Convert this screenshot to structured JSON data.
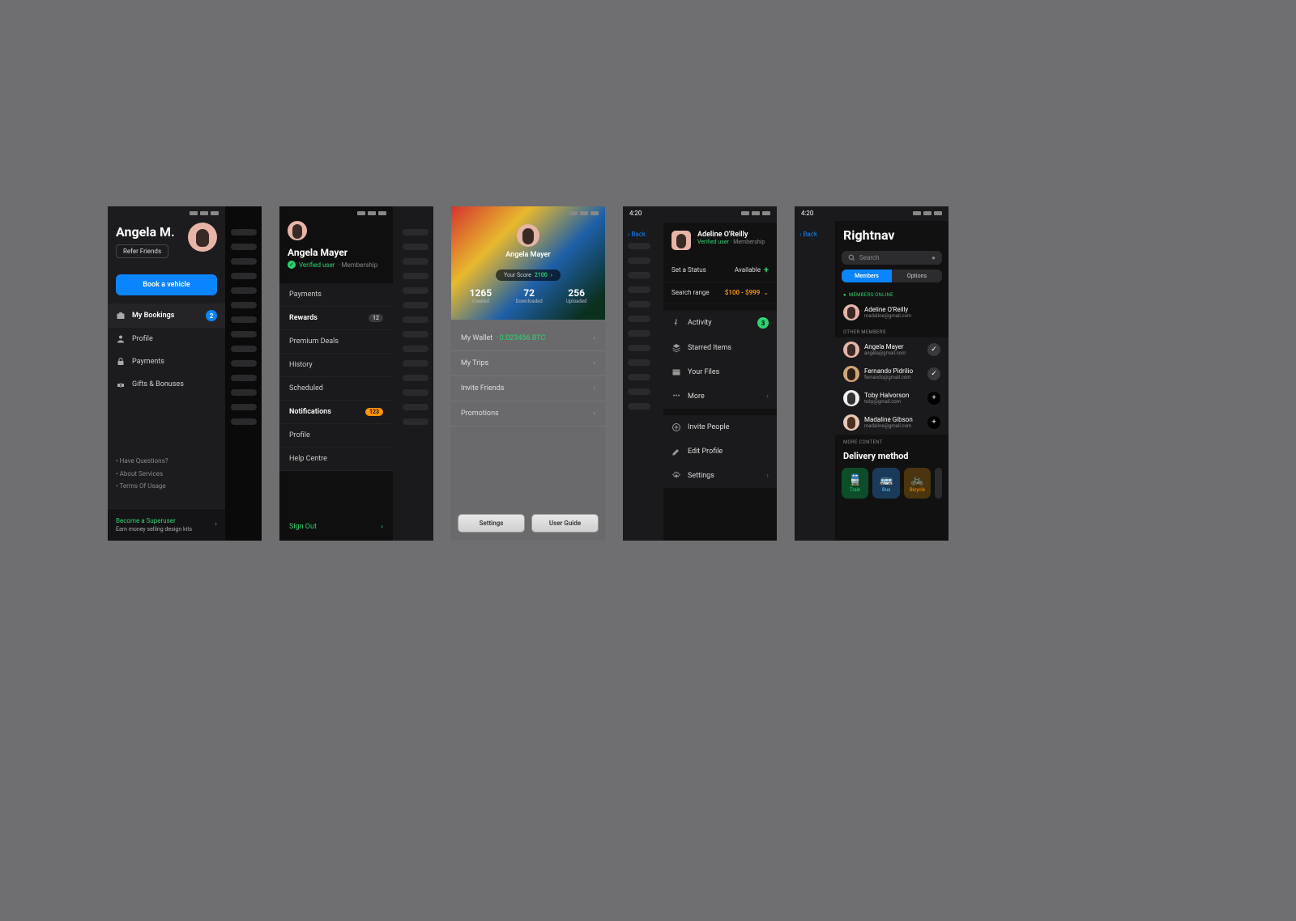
{
  "status": {
    "time": "4:20"
  },
  "p1": {
    "name": "Angela M.",
    "refer": "Refer Friends",
    "book": "Book a vehicle",
    "menu": [
      {
        "label": "My Bookings",
        "badge": "2",
        "active": true
      },
      {
        "label": "Profile"
      },
      {
        "label": "Payments"
      },
      {
        "label": "Gifts & Bonuses"
      }
    ],
    "links": [
      "• Have Questions?",
      "• About Services",
      "• Terms Of Usage"
    ],
    "cta_title": "Become a Superuser",
    "cta_sub": "Earn money selling design kits"
  },
  "p2": {
    "name": "Angela Mayer",
    "verified": "Verified user",
    "membership": "· Membership",
    "menu": [
      {
        "label": "Payments"
      },
      {
        "label": "Rewards",
        "bold": true,
        "badge_gray": "12"
      },
      {
        "label": "Premium Deals"
      },
      {
        "label": "History"
      },
      {
        "label": "Scheduled"
      },
      {
        "label": "Notifications",
        "bold": true,
        "badge_orange": "123"
      },
      {
        "label": "Profile"
      },
      {
        "label": "Help Centre"
      }
    ],
    "signout": "Sign Out"
  },
  "p3": {
    "name": "Angela Mayer",
    "score_label": "Your Score",
    "score_value": "2100",
    "stats": [
      {
        "n": "1265",
        "l": "Created"
      },
      {
        "n": "72",
        "l": "Downloaded"
      },
      {
        "n": "256",
        "l": "Uploaded"
      }
    ],
    "menu": [
      {
        "label": "My Wallet",
        "amount": "· 0.023456 BTC"
      },
      {
        "label": "My Trips"
      },
      {
        "label": "Invite Friends"
      },
      {
        "label": "Promotions"
      }
    ],
    "btn1": "Settings",
    "btn2": "User Guide"
  },
  "p4": {
    "back": "Back",
    "name": "Adeline O'Reilly",
    "verified": "Verified user",
    "membership": "· Membership",
    "status_label": "Set a Status",
    "status_value": "Available",
    "range_label": "Search range",
    "range_value": "$100 - $999",
    "section1": [
      {
        "label": "Activity",
        "badge": "3"
      },
      {
        "label": "Starred Items"
      },
      {
        "label": "Your Files"
      },
      {
        "label": "More",
        "chevron": true
      }
    ],
    "section2": [
      {
        "label": "Invite People"
      },
      {
        "label": "Edit Profile"
      },
      {
        "label": "Settings",
        "chevron": true
      }
    ]
  },
  "p5": {
    "back": "Back",
    "title": "Rightnav",
    "search": "Search",
    "seg1": "Members",
    "seg2": "Options",
    "hdr_online": "MEMBERS ONLINE",
    "hdr_other": "OTHER MEMBERS",
    "hdr_more": "MORE CONTENT",
    "online": [
      {
        "name": "Adeline O'Reilly",
        "email": "madaline@gmail.com"
      }
    ],
    "others": [
      {
        "name": "Angela Mayer",
        "email": "angela@gmail.com",
        "action": "check"
      },
      {
        "name": "Fernando Pidrilio",
        "email": "fernando@gmail.com",
        "action": "check"
      },
      {
        "name": "Toby Halvorson",
        "email": "toby@gmail.com",
        "action": "plus"
      },
      {
        "name": "Madaline Gibson",
        "email": "madaline@gmail.com",
        "action": "plus"
      }
    ],
    "delivery": "Delivery method",
    "chips": [
      {
        "label": "Train"
      },
      {
        "label": "Bus"
      },
      {
        "label": "Bicycle"
      }
    ]
  }
}
